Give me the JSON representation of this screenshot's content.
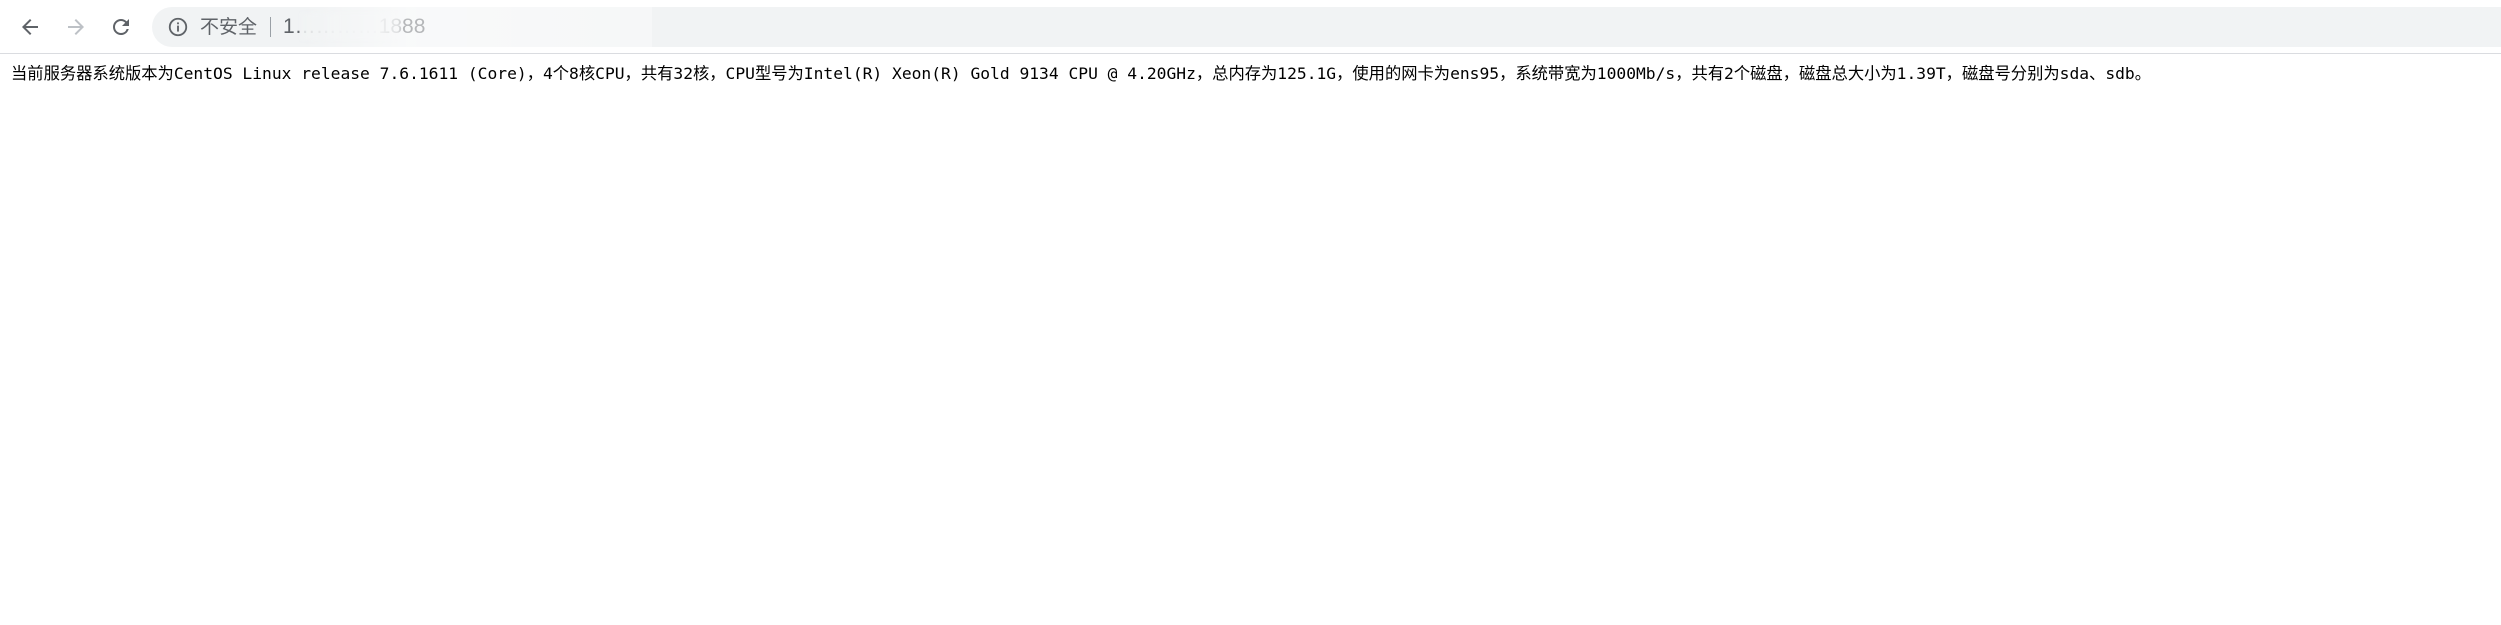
{
  "browser": {
    "back_icon": "arrow-left-icon",
    "forward_icon": "arrow-right-icon",
    "reload_icon": "reload-icon",
    "security_icon": "info-circle-icon",
    "security_label": "不安全",
    "url": "1​…………1888",
    "colors": {
      "omnibox_bg": "#f1f3f4",
      "icon": "#5f6368",
      "forward_disabled": "#bdc1c6"
    }
  },
  "page": {
    "text": "当前服务器系统版本为CentOS Linux release 7.6.1611 (Core)，4个8核CPU，共有32核，CPU型号为Intel(R) Xeon(R) Gold 9134 CPU @ 4.20GHz，总内存为125.1G，使用的网卡为ens95，系统带宽为1000Mb/s，共有2个磁盘，磁盘总大小为1.39T，磁盘号分别为sda、sdb。"
  }
}
